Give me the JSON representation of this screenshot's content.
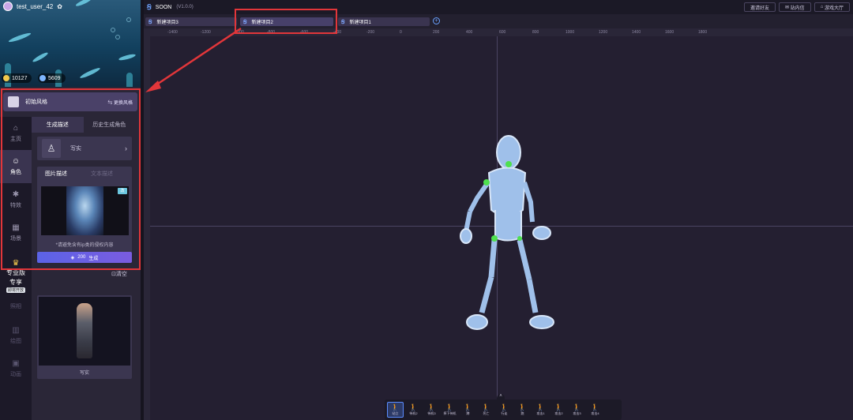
{
  "user": {
    "username": "test_user_42",
    "coins": "10127",
    "gems": "5609"
  },
  "style": {
    "name": "初始风格",
    "change_label": "更换风格"
  },
  "nav": [
    {
      "label": "主页",
      "icon": "home-icon",
      "glyph": "⌂"
    },
    {
      "label": "角色",
      "icon": "character-icon",
      "glyph": "☺"
    },
    {
      "label": "特效",
      "icon": "effects-icon",
      "glyph": "✱"
    },
    {
      "label": "场景",
      "icon": "scene-icon",
      "glyph": "▦"
    }
  ],
  "pro": {
    "title": "专业版",
    "subtitle": "专享",
    "badge": "即将开放",
    "items": [
      "照相",
      "绘图",
      "动画"
    ]
  },
  "panel": {
    "tabs": [
      "生成描述",
      "历史生成角色"
    ],
    "type_label": "写实",
    "desc_tabs": [
      "图片描述",
      "文本描述"
    ],
    "notice": "*请避免含有ip类的侵权内容",
    "image_badge": "改",
    "generate_cost": "200",
    "generate_label": "生成",
    "clear_label": "清空",
    "result_label": "写实"
  },
  "app": {
    "name": "SOON",
    "version": "(V1.0.0)"
  },
  "top_buttons": [
    "邀请好友",
    "站内信",
    "游戏大厅"
  ],
  "project_tabs": [
    "新建项目3",
    "新建项目2",
    "新建项目1"
  ],
  "ruler_labels": [
    "-1400",
    "-1200",
    "-1000",
    "-800",
    "-600",
    "-400",
    "-200",
    "0",
    "200",
    "400",
    "600",
    "800",
    "1000",
    "1200",
    "1400",
    "1600",
    "1800"
  ],
  "poses": [
    "站立",
    "待机2",
    "待机3",
    "摔下待机",
    "蹲",
    "死亡",
    "行走",
    "跑",
    "攻击1",
    "攻击2",
    "攻击3",
    "攻击4"
  ],
  "colors": {
    "accent": "#5b63e6",
    "highlight": "#e2363a",
    "skeleton": "#9fc0ea",
    "joint": "#4ee04e"
  }
}
